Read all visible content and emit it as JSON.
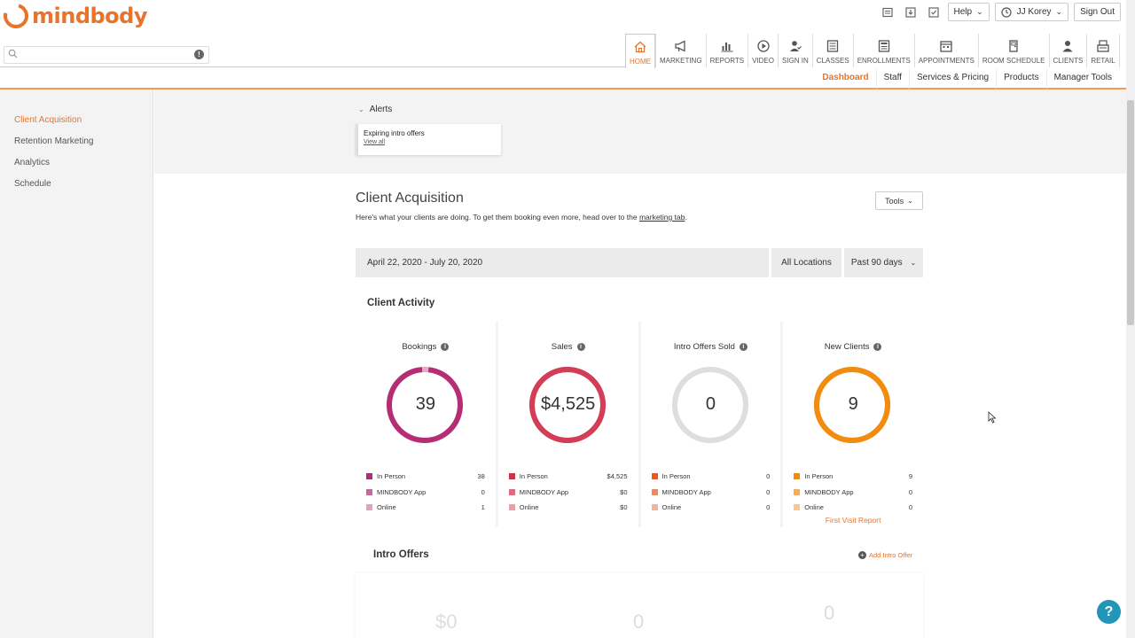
{
  "brand": {
    "name": "mindbody",
    "color": "#e8742b"
  },
  "search": {
    "placeholder": ""
  },
  "top_bar": {
    "help_label": "Help",
    "user_label": "JJ Korey",
    "sign_out_label": "Sign Out"
  },
  "main_nav": [
    {
      "label": "HOME",
      "icon": "home-icon",
      "active": true
    },
    {
      "label": "MARKETING",
      "icon": "megaphone-icon"
    },
    {
      "label": "REPORTS",
      "icon": "bar-chart-icon"
    },
    {
      "label": "VIDEO",
      "icon": "play-icon"
    },
    {
      "label": "SIGN IN",
      "icon": "user-check-icon"
    },
    {
      "label": "CLASSES",
      "icon": "classes-icon"
    },
    {
      "label": "ENROLLMENTS",
      "icon": "enrollments-icon"
    },
    {
      "label": "APPOINTMENTS",
      "icon": "appointments-icon"
    },
    {
      "label": "ROOM SCHEDULE",
      "icon": "door-icon"
    },
    {
      "label": "CLIENTS",
      "icon": "person-icon"
    },
    {
      "label": "RETAIL",
      "icon": "register-icon"
    }
  ],
  "sub_nav": [
    {
      "label": "Dashboard",
      "active": true
    },
    {
      "label": "Staff"
    },
    {
      "label": "Services & Pricing"
    },
    {
      "label": "Products"
    },
    {
      "label": "Manager Tools"
    }
  ],
  "sidebar": {
    "items": [
      {
        "label": "Client Acquisition",
        "active": true
      },
      {
        "label": "Retention Marketing"
      },
      {
        "label": "Analytics"
      },
      {
        "label": "Schedule"
      }
    ]
  },
  "alerts": {
    "toggle_label": "Alerts",
    "card_title": "Expiring intro offers",
    "card_link": "View all"
  },
  "page": {
    "title": "Client Acquisition",
    "subtitle_prefix": "Here's what your clients are doing. To get them booking even more, head over to the ",
    "subtitle_link": "marketing tab",
    "subtitle_suffix": ".",
    "tools_label": "Tools"
  },
  "filters": {
    "date_range": "April 22, 2020 - July 20, 2020",
    "location": "All Locations",
    "period": "Past 90 days"
  },
  "client_activity": {
    "title": "Client Activity",
    "cards": [
      {
        "title": "Bookings",
        "value": "39",
        "ring_color": "#b52d74",
        "gap_color": "#e8a7c8",
        "fill": 0.97,
        "legend": [
          {
            "label": "In Person",
            "value": "38",
            "color": "#a83077"
          },
          {
            "label": "MINDBODY App",
            "value": "0",
            "color": "#c9669e"
          },
          {
            "label": "Online",
            "value": "1",
            "color": "#e6a0c6"
          }
        ]
      },
      {
        "title": "Sales",
        "value": "$4,525",
        "ring_color": "#d33d55",
        "gap_color": "#d33d55",
        "fill": 1,
        "legend": [
          {
            "label": "In Person",
            "value": "$4,525",
            "color": "#c8344c"
          },
          {
            "label": "MINDBODY App",
            "value": "$0",
            "color": "#de6b7e"
          },
          {
            "label": "Online",
            "value": "$0",
            "color": "#ec9faa"
          }
        ]
      },
      {
        "title": "Intro Offers Sold",
        "value": "0",
        "ring_color": "#dedede",
        "gap_color": "#dedede",
        "fill": 1,
        "legend": [
          {
            "label": "In Person",
            "value": "0",
            "color": "#e55a24"
          },
          {
            "label": "MINDBODY App",
            "value": "0",
            "color": "#ec8a66"
          },
          {
            "label": "Online",
            "value": "0",
            "color": "#f3b498"
          }
        ]
      },
      {
        "title": "New Clients",
        "value": "9",
        "ring_color": "#f28c0e",
        "gap_color": "#f28c0e",
        "fill": 1,
        "legend": [
          {
            "label": "In Person",
            "value": "9",
            "color": "#f28c0e"
          },
          {
            "label": "MINDBODY App",
            "value": "0",
            "color": "#f6ae56"
          },
          {
            "label": "Online",
            "value": "0",
            "color": "#f9c98f"
          }
        ],
        "link": "First Visit Report"
      }
    ]
  },
  "intro_offers": {
    "title": "Intro Offers",
    "add_label": "Add Intro Offer",
    "faded_values": [
      "$0",
      "0",
      "0"
    ]
  },
  "help_fab": "?"
}
